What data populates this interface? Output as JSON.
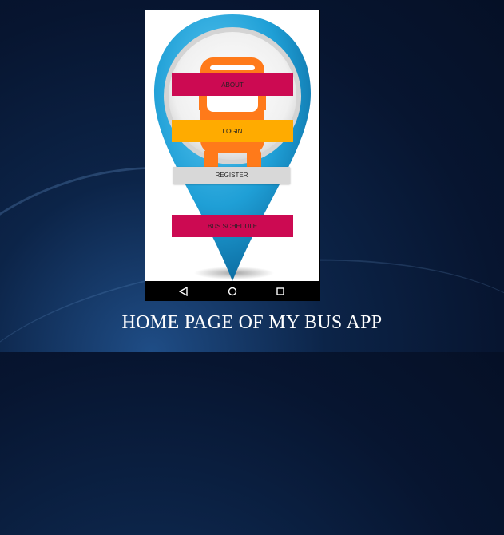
{
  "buttons": {
    "about": "ABOUT",
    "login": "LOGIN",
    "register": "REGISTER",
    "bus_schedule": "BUS SCHEDULE"
  },
  "navigation": {
    "back_icon": "triangle-back-icon",
    "home_icon": "circle-home-icon",
    "recents_icon": "square-recents-icon"
  },
  "caption": "HOME PAGE OF MY BUS APP",
  "colors": {
    "about_button": "#cc0a52",
    "login_button": "#ffab00",
    "register_button": "#d8d8d8",
    "schedule_button": "#cc0a52",
    "pin_blue": "#2aa7dc",
    "bus_orange": "#ff7a1a",
    "background": "#0c2448"
  }
}
